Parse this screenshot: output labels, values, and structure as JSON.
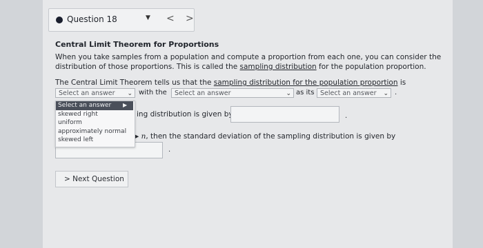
{
  "question_nav": {
    "label": "Question 18",
    "prev_glyph": "<",
    "next_glyph": ">"
  },
  "content": {
    "title": "Central Limit Theorem for Proportions",
    "intro_part1": "When you take samples from a population and compute a proportion from each one, you can consider the",
    "intro_part2_pre": "distribution of those proportions. This is called the ",
    "intro_link": "sampling distribution",
    "intro_part2_post": " for the population proportion.",
    "clt_pre": "The Central Limit Theorem tells us that the ",
    "clt_link": "sampling distribution for the population proportion",
    "clt_post": " is",
    "with_the": "with the",
    "as_its": "as its",
    "select_1": "Select an answer",
    "select_2": "Select an answer",
    "select_3": "Select an answer",
    "line3_text": "ing distribution is given by",
    "line4_pre": "",
    "line4_n": "n",
    "line4_post": ", then the standard deviation of the sampling distribution is given by",
    "period": "."
  },
  "dropdown": {
    "options": [
      "Select an answer",
      "skewed right",
      "uniform",
      "approximately normal",
      "skewed left"
    ],
    "selected": "Select an answer"
  },
  "buttons": {
    "next_label": "Next Question",
    "next_icon": ">"
  }
}
